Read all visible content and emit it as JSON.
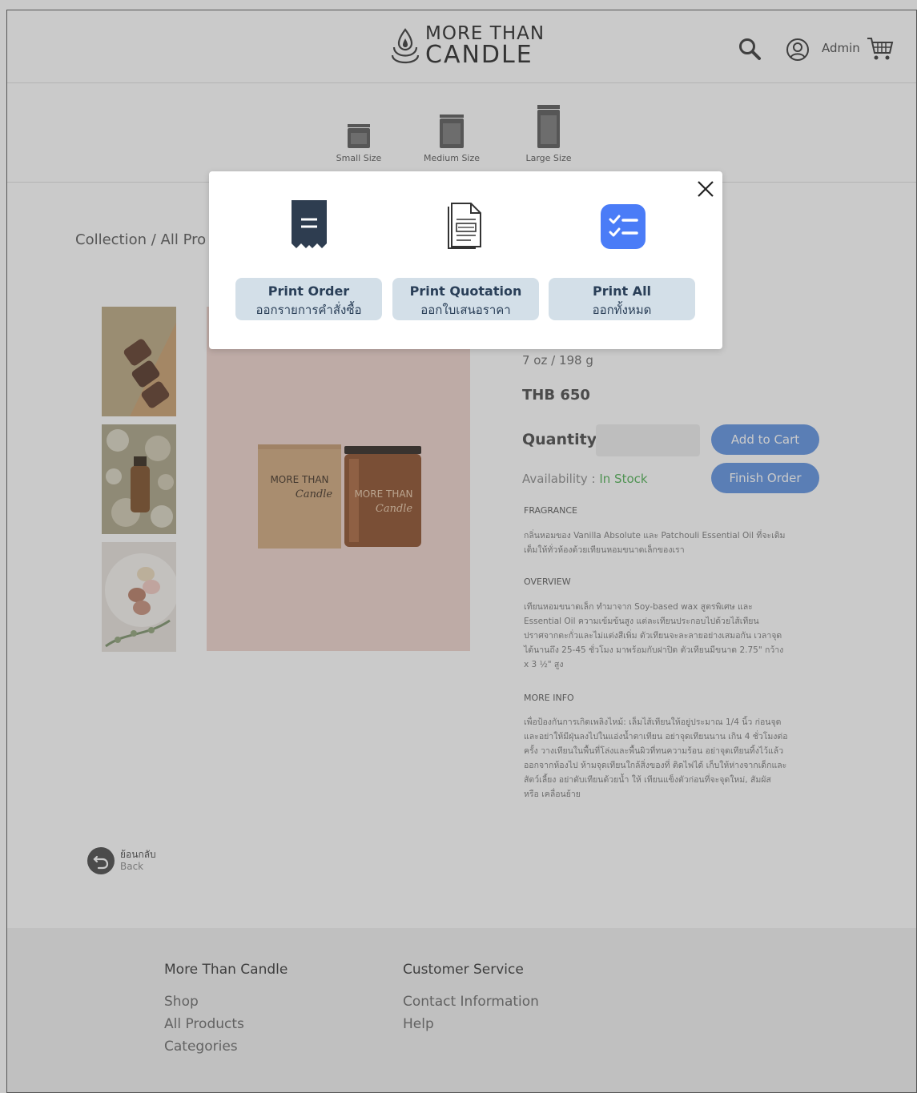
{
  "header": {
    "logo_line1": "MORE THAN",
    "logo_line2": "CANDLE",
    "admin_label": "Admin"
  },
  "sizes": [
    {
      "label": "Small Size"
    },
    {
      "label": "Medium Size"
    },
    {
      "label": "Large Size"
    }
  ],
  "breadcrumb": "Collection / All Pro",
  "product": {
    "weight": "7 oz / 198 g",
    "price": "THB 650",
    "quantity_label": "Quantity",
    "add_to_cart": "Add to Cart",
    "finish_order": "Finish Order",
    "availability_label": "Availability : ",
    "availability_value": "In Stock",
    "box_line1": "MORE THAN",
    "box_line2": "Candle",
    "jar_line1": "MORE THAN",
    "jar_line2": "Candle",
    "fragrance_title": "FRAGRANCE",
    "fragrance_text": "กลิ่นหอมของ Vanilla Absolute และ Patchouli Essential Oil ที่จะเติมเต็มให้ทั่วห้องด้วยเทียนหอมขนาดเล็กของเรา",
    "overview_title": "OVERVIEW",
    "overview_text": "เทียนหอมขนาดเล็ก ทำมาจาก Soy-based wax สูตรพิเศษ และ Essential Oil ความเข้มข้นสูง แต่ละเทียนประกอบไปด้วยไส้เทียน ปราศจากตะกั่วและไม่แต่งสีเพิ่ม ตัวเทียนจะละลายอย่างเสมอกัน เวลาจุดได้นานถึง 25-45 ชั่วโมง มาพร้อมกับฝาปิด ตัวเทียนมีขนาด 2.75\" กว้าง x 3 ½\" สูง",
    "moreinfo_title": "MORE INFO",
    "moreinfo_text": "เพื่อป้องกันการเกิดเพลิงไหม้: เล็มไส้เทียนให้อยู่ประมาณ 1/4 นิ้ว ก่อนจุด และอย่าให้มีฝุ่นลงไปในแอ่งน้ำตาเทียน อย่าจุดเทียนนาน เกิน 4 ชั่วโมงต่อครั้ง วางเทียนในพื้นที่โล่งและพื้นผิวที่ทนความร้อน อย่าจุดเทียนทิ้งไว้แล้วออกจากห้องไป ห้ามจุดเทียนใกล้สิ่งของที่ ติดไฟได้ เก็บให้ห่างจากเด็กและสัตว์เลี้ยง อย่าดับเทียนด้วยน้ำ ให้ เทียนแข็งตัวก่อนที่จะจุดใหม่, สัมผัส หรือ เคลื่อนย้าย"
  },
  "back": {
    "th": "ย้อนกลับ",
    "en": "Back"
  },
  "footer": {
    "col1_title": "More Than Candle",
    "col1_links": [
      "Shop",
      "All Products",
      "Categories"
    ],
    "col2_title": "Customer Service",
    "col2_links": [
      "Contact Information",
      "Help"
    ]
  },
  "modal": {
    "buttons": [
      {
        "en": "Print Order",
        "th": "ออกรายการคำสั่งซื้อ",
        "icon": "receipt-icon"
      },
      {
        "en": "Print Quotation",
        "th": "ออกใบเสนอราคา",
        "icon": "document-icon"
      },
      {
        "en": "Print All",
        "th": "ออกทั้งหมด",
        "icon": "checklist-icon"
      }
    ]
  },
  "colors": {
    "accent_blue": "#5b8fe0",
    "print_button_bg": "#d3dfe8",
    "in_stock": "#4caf50",
    "receipt_icon": "#2e3d50",
    "checklist_icon": "#4a7cf7"
  }
}
